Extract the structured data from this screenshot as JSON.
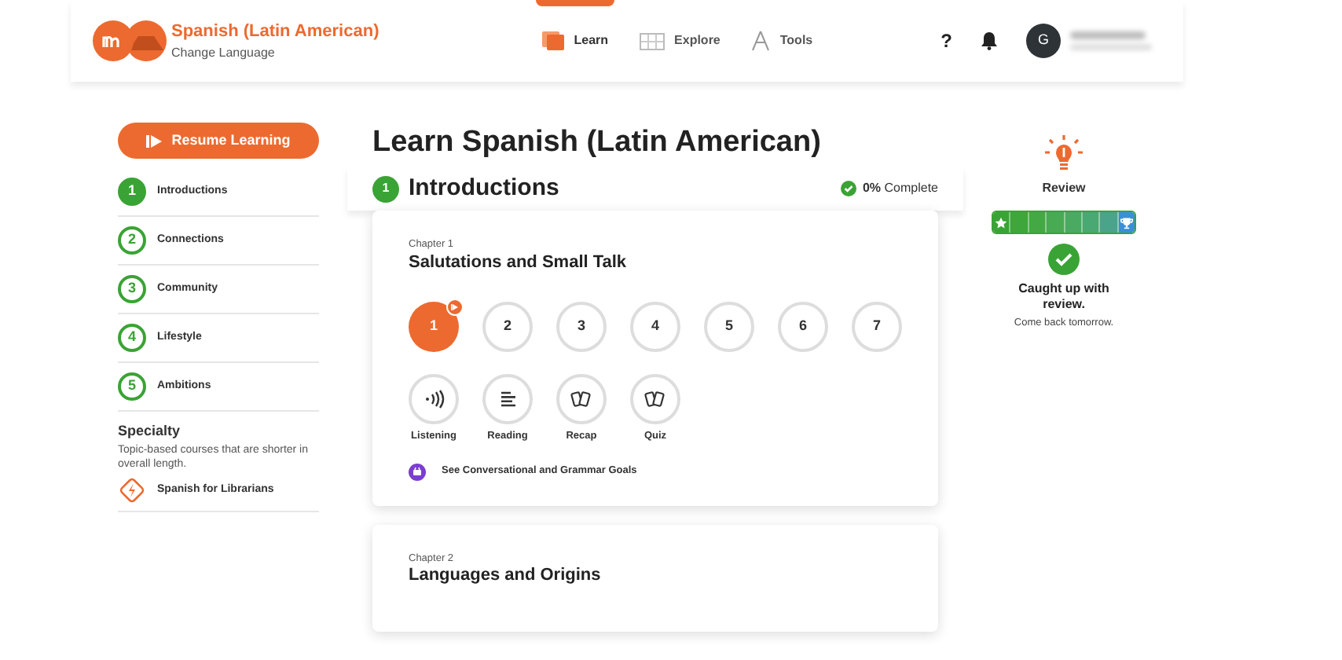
{
  "header": {
    "course_title": "Spanish (Latin American)",
    "change_language": "Change Language",
    "nav": [
      {
        "label": "Learn",
        "selected": true,
        "kind": "learn"
      },
      {
        "label": "Explore",
        "selected": false,
        "kind": "explore"
      },
      {
        "label": "Tools",
        "selected": false,
        "kind": "tools"
      }
    ],
    "help": "?",
    "avatar_initial": "G"
  },
  "sidebar": {
    "resume_button": "Resume Learning",
    "units": [
      {
        "number": "1",
        "label": "Introductions",
        "selected": true
      },
      {
        "number": "2",
        "label": "Connections",
        "selected": false
      },
      {
        "number": "3",
        "label": "Community",
        "selected": false
      },
      {
        "number": "4",
        "label": "Lifestyle",
        "selected": false
      },
      {
        "number": "5",
        "label": "Ambitions",
        "selected": false
      }
    ],
    "specialty": {
      "title": "Specialty",
      "description": "Topic-based courses that are shorter in overall length.",
      "courses": [
        "Spanish for Librarians"
      ]
    }
  },
  "main": {
    "title": "Learn Spanish (Latin American)",
    "unit_number": "1",
    "unit_title": "Introductions",
    "progress": "**0%** Complete",
    "chapters": [
      {
        "chapter": "Chapter 1",
        "title": "Salutations and Small Talk",
        "lessons": [
          {
            "label": "1",
            "selected": true
          },
          {
            "label": "2",
            "selected": false
          },
          {
            "label": "3",
            "selected": false
          },
          {
            "label": "4",
            "selected": false
          },
          {
            "label": "5",
            "selected": false
          },
          {
            "label": "6",
            "selected": false
          },
          {
            "label": "7",
            "selected": false
          }
        ],
        "activities": [
          {
            "label": "Listening",
            "kind": "listening"
          },
          {
            "label": "Reading",
            "kind": "reading"
          },
          {
            "label": "Recap",
            "kind": "cards"
          },
          {
            "label": "Quiz",
            "kind": "cards"
          }
        ],
        "goals_link": "See Conversational and Grammar Goals"
      },
      {
        "chapter": "Chapter 2",
        "title": "Languages and Origins"
      }
    ]
  },
  "review": {
    "title": "Review",
    "status": "Caught up with review.",
    "note": "Come back tomorrow."
  }
}
